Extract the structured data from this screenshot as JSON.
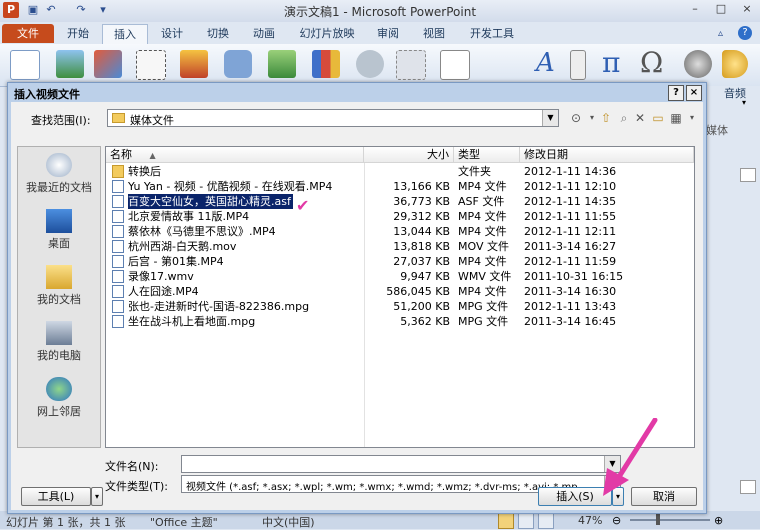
{
  "app": {
    "title": "演示文稿1 - Microsoft PowerPoint",
    "logo": "P",
    "window_controls": [
      "–",
      "□",
      "×"
    ]
  },
  "ribbon": {
    "file_tab": "文件",
    "tabs": [
      "开始",
      "插入",
      "设计",
      "切换",
      "动画",
      "幻灯片放映",
      "审阅",
      "视图",
      "开发工具"
    ],
    "active_tab": "插入",
    "visible_labels": {
      "audio": "音频",
      "media_group": "媒体"
    }
  },
  "dialog": {
    "title": "插入视频文件",
    "help": "?",
    "close": "×",
    "lookin_label": "查找范围(I):",
    "lookin_value": "媒体文件",
    "places": [
      {
        "label": "我最近的文档",
        "icon": "recent-documents-icon"
      },
      {
        "label": "桌面",
        "icon": "desktop-icon"
      },
      {
        "label": "我的文档",
        "icon": "my-documents-icon"
      },
      {
        "label": "我的电脑",
        "icon": "my-computer-icon"
      },
      {
        "label": "网上邻居",
        "icon": "network-places-icon"
      }
    ],
    "columns": [
      "名称",
      "大小",
      "类型",
      "修改日期"
    ],
    "files": [
      {
        "name": "转换后",
        "size": "",
        "type": "文件夹",
        "date": "2012-1-11 14:36",
        "icon": "folder"
      },
      {
        "name": "Yu Yan - 视频 - 优酷视频 - 在线观看.MP4",
        "size": "13,166 KB",
        "type": "MP4 文件",
        "date": "2012-1-11 12:10",
        "icon": "MP4"
      },
      {
        "name": "百变大空仙女，英国甜心精灵.asf",
        "size": "36,773 KB",
        "type": "ASF 文件",
        "date": "2012-1-11 14:35",
        "icon": "ASF",
        "selected": true
      },
      {
        "name": "北京爱情故事 11版.MP4",
        "size": "29,312 KB",
        "type": "MP4 文件",
        "date": "2012-1-11 11:55",
        "icon": "MP4"
      },
      {
        "name": "蔡依林《马德里不思议》.MP4",
        "size": "13,044 KB",
        "type": "MP4 文件",
        "date": "2012-1-11 12:11",
        "icon": "MP4"
      },
      {
        "name": "杭州西湖-白天鹅.mov",
        "size": "13,818 KB",
        "type": "MOV 文件",
        "date": "2011-3-14 16:27",
        "icon": "MOV"
      },
      {
        "name": "后宫 - 第01集.MP4",
        "size": "27,037 KB",
        "type": "MP4 文件",
        "date": "2012-1-11 11:59",
        "icon": "MP4"
      },
      {
        "name": "录像17.wmv",
        "size": "9,947 KB",
        "type": "WMV 文件",
        "date": "2011-10-31 16:15",
        "icon": "WMV"
      },
      {
        "name": "人在囧途.MP4",
        "size": "586,045 KB",
        "type": "MP4 文件",
        "date": "2011-3-14 16:30",
        "icon": "MP4"
      },
      {
        "name": "张也-走进新时代-国语-822386.mpg",
        "size": "51,200 KB",
        "type": "MPG 文件",
        "date": "2012-1-11 13:43",
        "icon": "MPG"
      },
      {
        "name": "坐在战斗机上看地面.mpg",
        "size": "5,362 KB",
        "type": "MPG 文件",
        "date": "2011-3-14 16:45",
        "icon": "MPG"
      }
    ],
    "filename_label": "文件名(N):",
    "filename_value": "",
    "filetype_label": "文件类型(T):",
    "filetype_value": "视频文件 (*.asf; *.asx; *.wpl; *.wm; *.wmx; *.wmd; *.wmz; *.dvr-ms; *.avi; *.mp",
    "tools_label": "工具(L)",
    "insert_label": "插入(S)",
    "cancel_label": "取消"
  },
  "statusbar": {
    "slide_info": "幻灯片 第 1 张，共 1 张",
    "theme": "\"Office 主题\"",
    "language": "中文(中国)",
    "zoom": "47%"
  },
  "colors": {
    "file_tab": "#c64b1c",
    "selection": "#0a246a",
    "annotation_pink": "#e23aa6"
  }
}
